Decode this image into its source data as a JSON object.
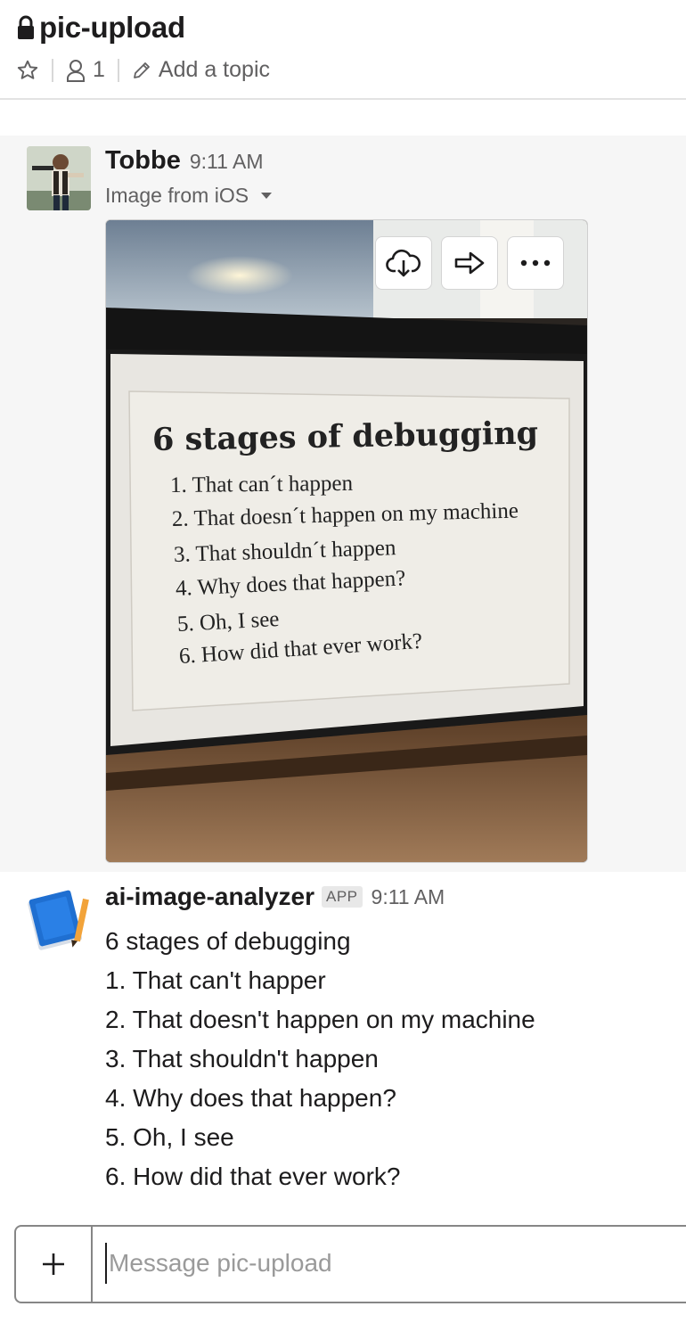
{
  "header": {
    "channel_name": "pic-upload",
    "member_count": "1",
    "topic_link": "Add a topic"
  },
  "message1": {
    "sender": "Tobbe",
    "time": "9:11 AM",
    "file_title": "Image from iOS",
    "poster": {
      "title": "6 stages of debugging",
      "lines": [
        "1. That can´t happen",
        "2. That doesn´t happen on my machine",
        "3. That shouldn´t happen",
        "4. Why does that happen?",
        "5. Oh, I see",
        "6. How did that ever work?"
      ]
    },
    "actions": [
      "download-icon",
      "share-icon",
      "more-icon"
    ]
  },
  "message2": {
    "sender": "ai-image-analyzer",
    "badge": "APP",
    "time": "9:11 AM",
    "lines": [
      "6 stages of debugging",
      "1. That can't happer",
      "2. That doesn't happen on my machine",
      "3. That shouldn't happen",
      "4. Why does that happen?",
      "5. Oh, I see",
      "6. How did that ever work?"
    ]
  },
  "composer": {
    "placeholder": "Message pic-upload"
  },
  "colors": {
    "text": "#1d1c1d",
    "muted": "#616061",
    "message_highlight": "#f6f6f6"
  }
}
